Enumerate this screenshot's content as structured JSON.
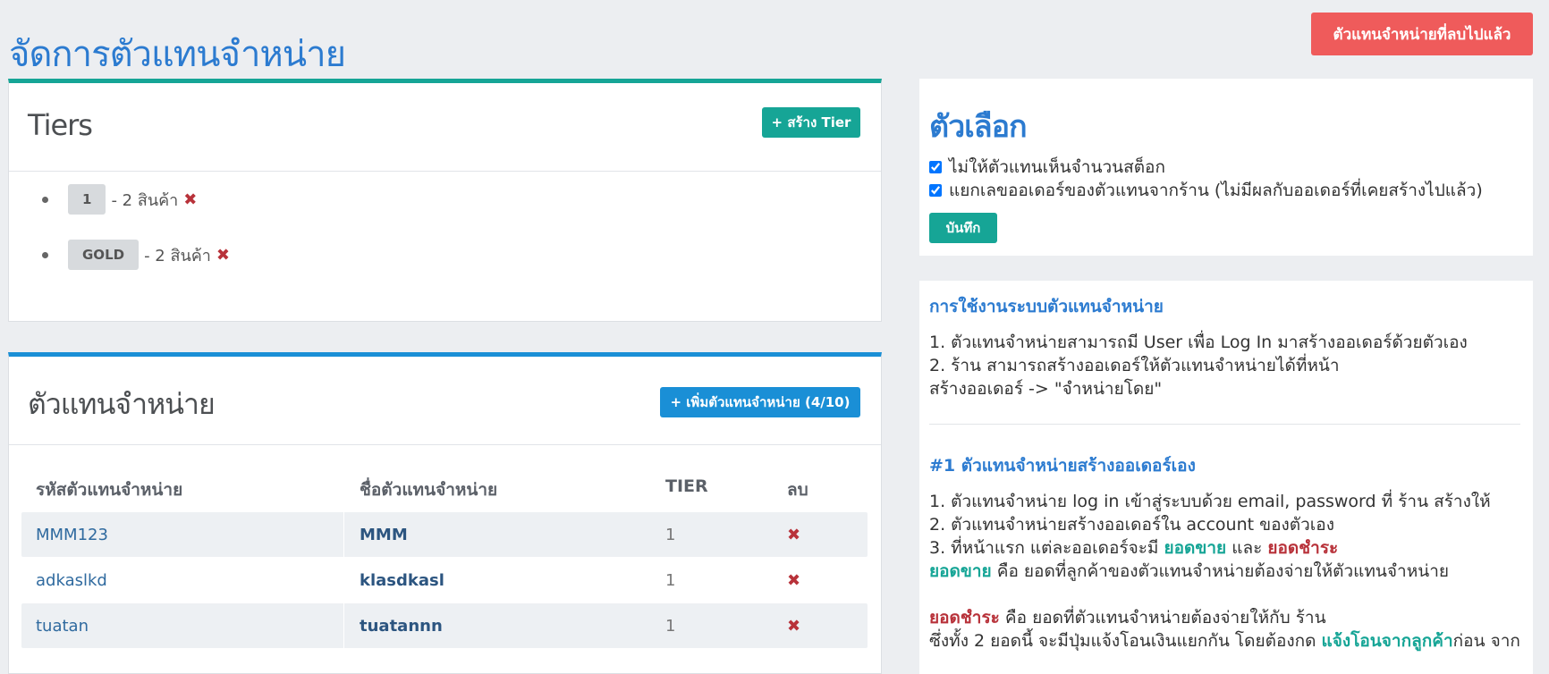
{
  "page": {
    "title": "จัดการตัวแทนจำหน่าย",
    "deleted_button": "ตัวแทนจำหน่ายที่ลบไปแล้ว"
  },
  "tiers": {
    "title": "Tiers",
    "create_button": "+ สร้าง Tier",
    "items": [
      {
        "badge": "1",
        "text": "- 2 สินค้า"
      },
      {
        "badge": "GOLD",
        "text": "- 2 สินค้า"
      }
    ],
    "delete_glyph": "✖"
  },
  "agents": {
    "title": "ตัวแทนจำหน่าย",
    "add_button": "+ เพิ่มตัวแทนจำหน่าย (4/10)",
    "columns": [
      "รหัสตัวแทนจำหน่าย",
      "ชื่อตัวแทนจำหน่าย",
      "TIER",
      "ลบ"
    ],
    "rows": [
      {
        "code": "MMM123",
        "name": "MMM",
        "tier": "1"
      },
      {
        "code": "adkaslkd",
        "name": "klasdkasl",
        "tier": "1"
      },
      {
        "code": "tuatan",
        "name": "tuatannn",
        "tier": "1"
      }
    ],
    "delete_glyph": "✖"
  },
  "options": {
    "title": "ตัวเลือก",
    "check1": "ไม่ให้ตัวแทนเห็นจำนวนสต็อก",
    "check2": "แยกเลขออเดอร์ของตัวแทนจากร้าน (ไม่มีผลกับออเดอร์ที่เคยสร้างไปแล้ว)",
    "save_button": "บันทึก"
  },
  "help": {
    "heading1": "การใช้งานระบบตัวแทนจำหน่าย",
    "line1": "1. ตัวแทนจำหน่ายสามารถมี User เพื่อ Log In มาสร้างออเดอร์ด้วยตัวเอง",
    "line2": "2. ร้าน สามารถสร้างออเดอร์ให้ตัวแทนจำหน่ายได้ที่หน้า",
    "line3": "สร้างออเดอร์ -> \"จำหน่ายโดย\"",
    "heading2": "#1 ตัวแทนจำหน่ายสร้างออเดอร์เอง",
    "step1": "1. ตัวแทนจำหน่าย log in เข้าสู่ระบบด้วย email, password ที่ ร้าน สร้างให้",
    "step2": "2. ตัวแทนจำหน่ายสร้างออเดอร์ใน account ของตัวเอง",
    "step3_prefix": "3. ที่หน้าแรก แต่ละออเดอร์จะมี",
    "sales": "ยอดขาย",
    "and": "และ",
    "payment": "ยอดชำระ",
    "sales_def": "คือ ยอดที่ลูกค้าของตัวแทนจำหน่ายต้องจ่ายให้ตัวแทนจำหน่าย",
    "payment_def": "คือ ยอดที่ตัวแทนจำหน่ายต้องจ่ายให้กับ ร้าน",
    "last_prefix": "ซึ่งทั้ง 2 ยอดนี้ จะมีปุ่มแจ้งโอนเงินแยกกัน โดยต้องกด",
    "last_link": "แจ้งโอนจากลูกค้า",
    "last_suffix": "ก่อน จาก"
  }
}
